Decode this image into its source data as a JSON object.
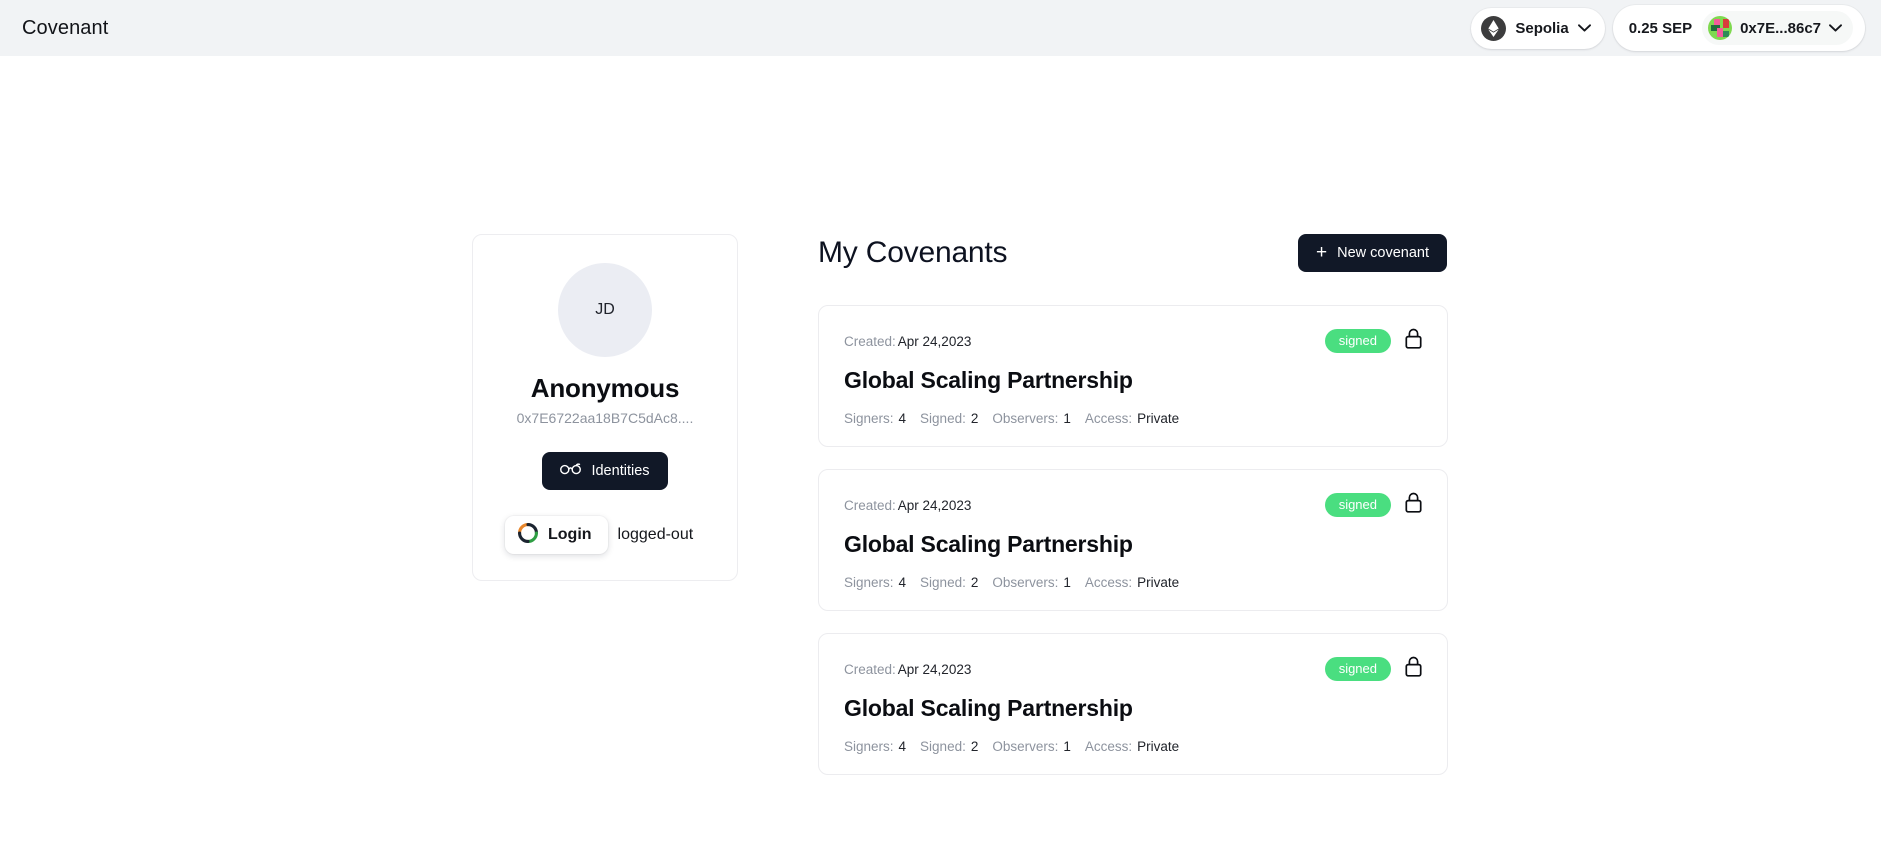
{
  "header": {
    "brand": "Covenant",
    "chain": {
      "name": "Sepolia",
      "icon": "ethereum-icon",
      "chevron": "chevron-down-icon"
    },
    "balance": "0.25 SEP",
    "account": {
      "address_short": "0x7E...86c7",
      "avatar_icon": "blockie-avatar",
      "chevron": "chevron-down-icon"
    }
  },
  "profile": {
    "avatar_initials": "JD",
    "display_name": "Anonymous",
    "wallet_address": "0x7E6722aa18B7C5dAc8....",
    "identities_button": {
      "label": "Identities",
      "icon": "glasses-icon"
    },
    "login_button": {
      "label": "Login",
      "icon": "segmented-ring-icon"
    },
    "login_status": "logged-out"
  },
  "main": {
    "title": "My Covenants",
    "new_covenant_button": {
      "label": "New covenant",
      "icon": "plus-icon"
    },
    "labels": {
      "created": "Created:",
      "signers": "Signers:",
      "signed": "Signed:",
      "observers": "Observers:",
      "access": "Access:"
    },
    "covenants": [
      {
        "created": "Apr 24,2023",
        "status": "signed",
        "lock_icon": "lock-closed-icon",
        "title": "Global Scaling Partnership",
        "signers": "4",
        "signed": "2",
        "observers": "1",
        "access": "Private"
      },
      {
        "created": "Apr 24,2023",
        "status": "signed",
        "lock_icon": "lock-closed-icon",
        "title": "Global Scaling Partnership",
        "signers": "4",
        "signed": "2",
        "observers": "1",
        "access": "Private"
      },
      {
        "created": "Apr 24,2023",
        "status": "signed",
        "lock_icon": "lock-closed-icon",
        "title": "Global Scaling Partnership",
        "signers": "4",
        "signed": "2",
        "observers": "1",
        "access": "Private"
      }
    ]
  },
  "colors": {
    "header_bg": "#f1f3f5",
    "accent_dark": "#111827",
    "status_green": "#4ade80",
    "muted_text": "#8d939e"
  }
}
